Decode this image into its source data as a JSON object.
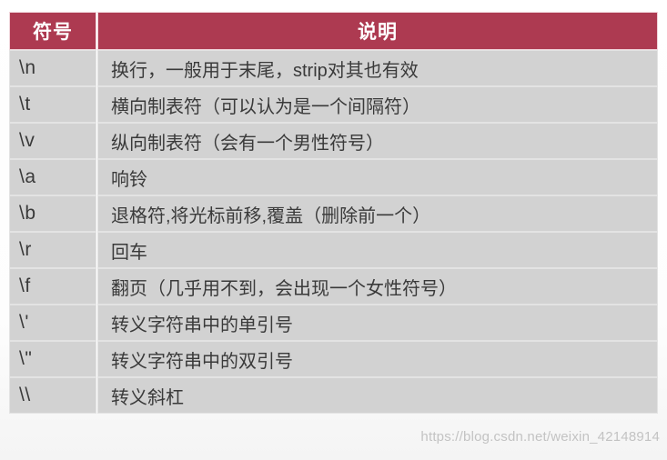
{
  "table": {
    "headers": {
      "symbol": "符号",
      "description": "说明"
    },
    "rows": [
      {
        "symbol": "\\n",
        "description": "换行，一般用于末尾，strip对其也有效"
      },
      {
        "symbol": "\\t",
        "description": "横向制表符（可以认为是一个间隔符）"
      },
      {
        "symbol": "\\v",
        "description": "纵向制表符（会有一个男性符号）"
      },
      {
        "symbol": "\\a",
        "description": "响铃"
      },
      {
        "symbol": "\\b",
        "description": "退格符,将光标前移,覆盖（删除前一个）"
      },
      {
        "symbol": "\\r",
        "description": "回车"
      },
      {
        "symbol": "\\f",
        "description": "翻页（几乎用不到，会出现一个女性符号）"
      },
      {
        "symbol": "\\'",
        "description": "转义字符串中的单引号"
      },
      {
        "symbol": "\\\"",
        "description": "转义字符串中的双引号"
      },
      {
        "symbol": "\\\\",
        "description": "转义斜杠"
      }
    ]
  },
  "watermark": {
    "text": "https://blog.csdn.net/weixin_42148914"
  },
  "colors": {
    "header_background": "#ad3a51",
    "header_text": "#ffffff",
    "cell_background": "#d2d2d2",
    "cell_text": "#3a3a3a",
    "page_background": "#ffffff",
    "watermark_text": "#c3c3c3"
  }
}
